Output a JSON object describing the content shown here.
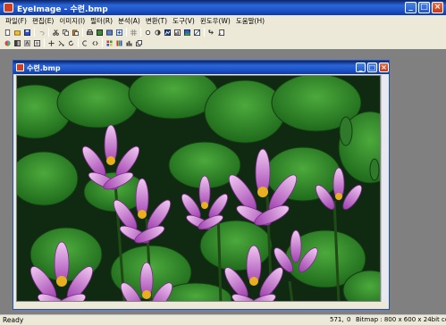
{
  "app": {
    "title": "EyeImage - 수련.bmp"
  },
  "menu": {
    "items": [
      "파일(F)",
      "편집(E)",
      "이미지(I)",
      "필터(R)",
      "분석(A)",
      "변환(T)",
      "도구(V)",
      "윈도우(W)",
      "도움말(H)"
    ]
  },
  "toolbar1": {
    "icons": [
      "new-file-icon",
      "open-folder-icon",
      "save-icon",
      "undo-icon",
      "cut-icon",
      "copy-icon",
      "paste-icon",
      "print-icon",
      "image-info-icon",
      "scan-icon",
      "resize-icon",
      "grid-icon",
      "brightness-icon",
      "contrast-icon",
      "histogram-icon",
      "levels-icon",
      "landscape-icon",
      "color-balance-icon",
      "arrow-right-icon",
      "rotate-icon"
    ]
  },
  "toolbar2": {
    "icons": [
      "palette-icon",
      "grayscale-icon",
      "emboss-icon",
      "frame-icon",
      "move-icon",
      "transform-icon",
      "refresh-icon",
      "flip-icon",
      "swap-icon",
      "channels-icon",
      "color-bars-icon",
      "bar-chart-icon",
      "copy-window-icon"
    ]
  },
  "child_window": {
    "title": "수련.bmp"
  },
  "status": {
    "left": "Ready",
    "coords": "571,",
    "value": "0",
    "info": "Bitmap : 800 x 600 x 24bit colo"
  },
  "colors": {
    "titlebar": "#1c52c8",
    "mdi_background": "#808080",
    "chrome": "#ece9d8",
    "lily_petal": "#c060c8",
    "leaf": "#2f8a28"
  }
}
